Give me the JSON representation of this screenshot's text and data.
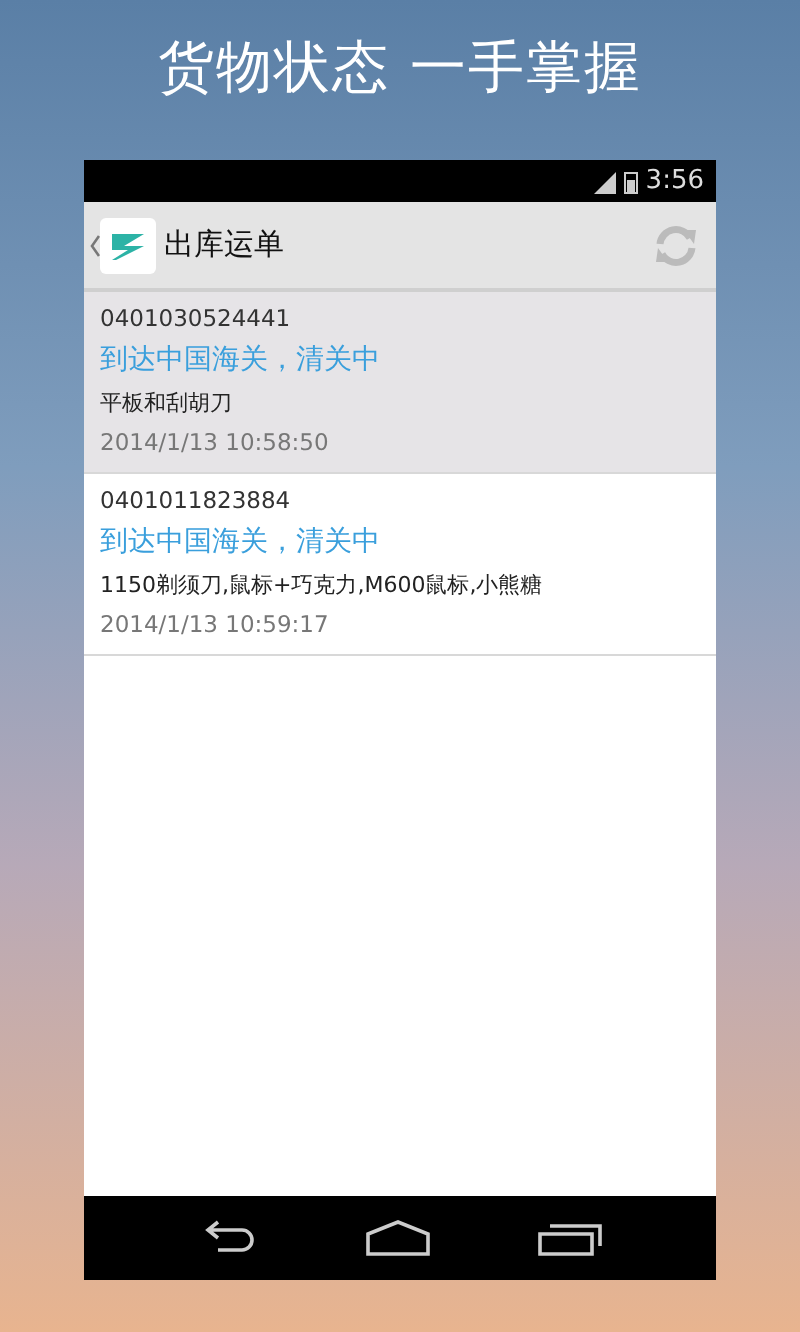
{
  "headline": "货物状态 一手掌握",
  "status_bar": {
    "time": "3:56"
  },
  "action_bar": {
    "title": "出库运单"
  },
  "orders": [
    {
      "number": "0401030524441",
      "status": "到达中国海关，清关中",
      "goods": "平板和刮胡刀",
      "time": "2014/1/13 10:58:50",
      "selected": true
    },
    {
      "number": "0401011823884",
      "status": "到达中国海关，清关中",
      "goods": "1150剃须刀,鼠标+巧克力,M600鼠标,小熊糖",
      "time": "2014/1/13 10:59:17",
      "selected": false
    }
  ]
}
